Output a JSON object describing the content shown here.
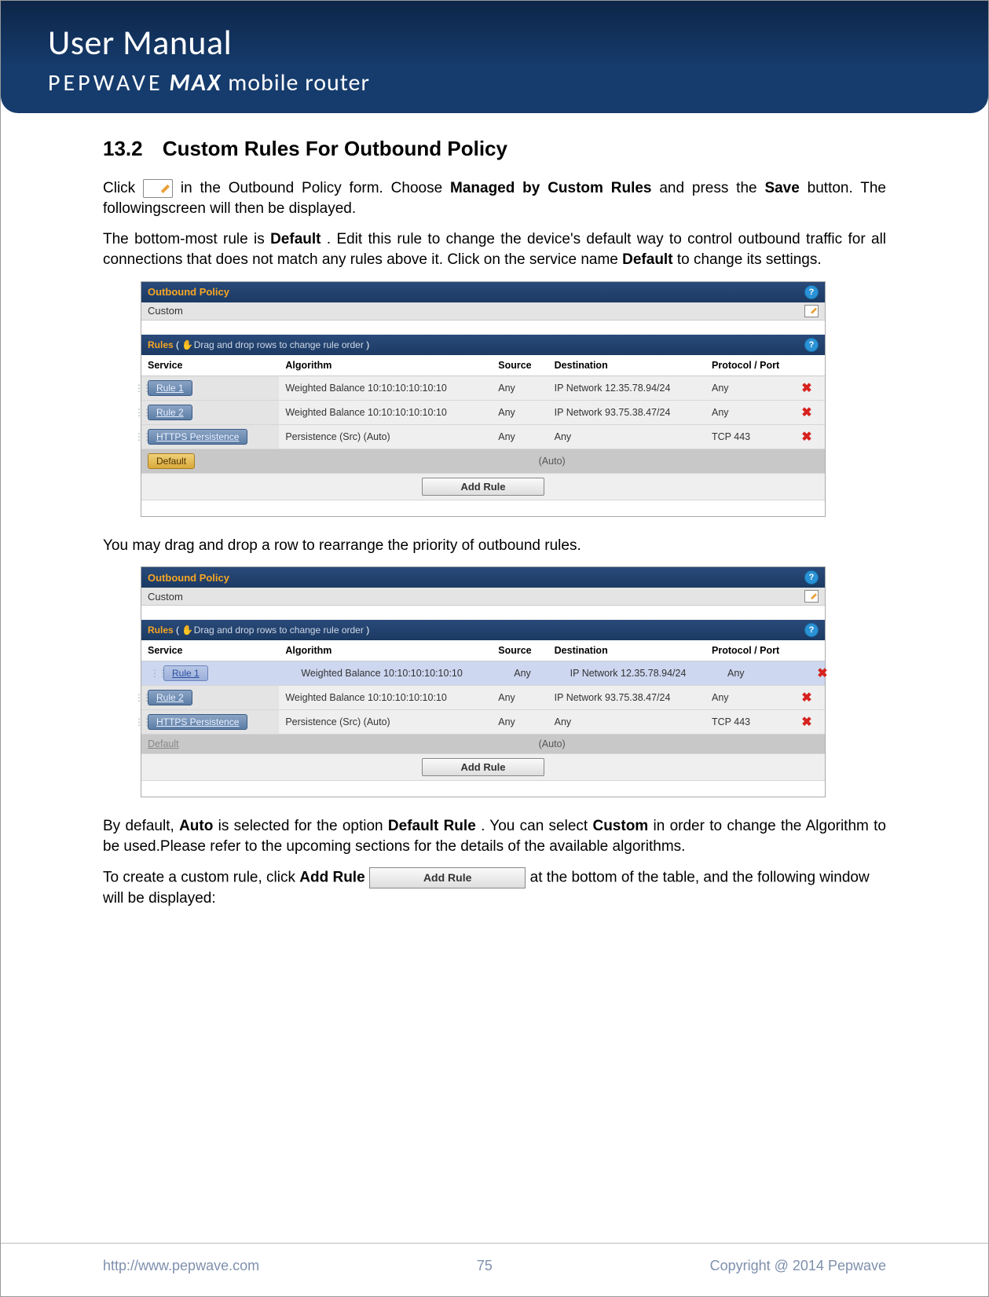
{
  "header": {
    "title": "User Manual",
    "brand": "PEPWAVE",
    "product_bold": "MAX",
    "product_tail": "mobile router"
  },
  "section": {
    "number": "13.2",
    "title": "Custom Rules For Outbound Policy"
  },
  "para1": {
    "pre": "Click ",
    "post_icon": "in the Outbound Policy form. Choose ",
    "bold1": "Managed by Custom Rules",
    "mid": " and press the ",
    "bold2": "Save",
    "tail": " button. The followingscreen will then be displayed."
  },
  "para2": {
    "pre": "The bottom-most rule is ",
    "bold1": "Default",
    "mid": ". Edit this rule to change the device's default way to control outbound traffic for all connections that does not match any rules above it. Click on the service name",
    "bold2": "Default",
    "tail": "to change its settings."
  },
  "panel": {
    "outbound_title": "Outbound Policy",
    "custom_label": "Custom",
    "rules_label": "Rules",
    "rules_hint": "Drag and drop rows to change rule order",
    "columns": {
      "service": "Service",
      "algorithm": "Algorithm",
      "source": "Source",
      "destination": "Destination",
      "protocol": "Protocol / Port"
    },
    "rows": [
      {
        "service": "Rule 1",
        "algorithm": "Weighted Balance 10:10:10:10:10:10",
        "source": "Any",
        "destination": "IP Network 12.35.78.94/24",
        "protocol": "Any"
      },
      {
        "service": "Rule 2",
        "algorithm": "Weighted Balance 10:10:10:10:10:10",
        "source": "Any",
        "destination": "IP Network 93.75.38.47/24",
        "protocol": "Any"
      },
      {
        "service": "HTTPS Persistence",
        "algorithm": "Persistence (Src) (Auto)",
        "source": "Any",
        "destination": "Any",
        "protocol": "TCP 443"
      }
    ],
    "default_label": "Default",
    "default_auto": "(Auto)",
    "add_rule": "Add Rule"
  },
  "para3": "You may drag and drop a row to rearrange the priority of outbound rules.",
  "panel2": {
    "rows": [
      {
        "service": "Rule 1",
        "algorithm": "Weighted Balance 10:10:10:10:10:10",
        "source": "Any",
        "destination": "IP Network 12.35.78.94/24",
        "protocol": "Any",
        "dragging": true
      },
      {
        "service": "Rule 2",
        "algorithm": "Weighted Balance 10:10:10:10:10:10",
        "source": "Any",
        "destination": "IP Network 93.75.38.47/24",
        "protocol": "Any"
      },
      {
        "service": "HTTPS Persistence",
        "algorithm": "Persistence (Src) (Auto)",
        "source": "Any",
        "destination": "Any",
        "protocol": "TCP 443"
      }
    ]
  },
  "para4": {
    "pre": "By default, ",
    "b1": "Auto",
    "m1": " is selected for the option ",
    "b2": "Default Rule",
    "m2": ". You can select ",
    "b3": "Custom",
    "tail": " in order to change the Algorithm to be used.Please refer to the upcoming sections for the details of the available algorithms."
  },
  "para5": {
    "pre": "To create a custom rule, click ",
    "b1": "Add Rule",
    "btn": "Add Rule",
    "tail": "at the bottom of the table, and the following window will be displayed:"
  },
  "footer": {
    "url": "http://www.pepwave.com",
    "page": "75",
    "copyright": "Copyright @ 2014 Pepwave"
  }
}
